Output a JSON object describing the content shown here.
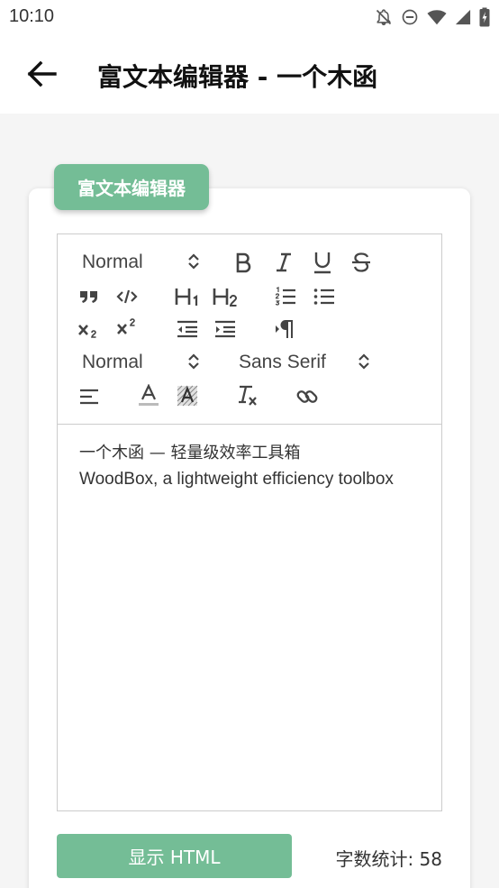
{
  "status_bar": {
    "time": "10:10",
    "icons": [
      "notifications-off-icon",
      "do-not-disturb-icon",
      "wifi-icon",
      "cell-signal-icon",
      "battery-icon"
    ]
  },
  "app_bar": {
    "title": "富文本编辑器 - 一个木函",
    "back_icon": "arrow-back-icon"
  },
  "card": {
    "tag_label": "富文本编辑器"
  },
  "toolbar": {
    "header_select": "Normal",
    "size_select": "Normal",
    "font_select": "Sans Serif",
    "h1_label": "H1",
    "h2_label": "H2"
  },
  "editor": {
    "lines": [
      "一个木函 — 轻量级效率工具箱",
      "WoodBox, a lightweight efficiency toolbox"
    ]
  },
  "footer": {
    "show_html_label": "显示 HTML",
    "word_count_label": "字数统计: 58"
  },
  "colors": {
    "accent": "#74bd96",
    "icon": "#444444"
  }
}
